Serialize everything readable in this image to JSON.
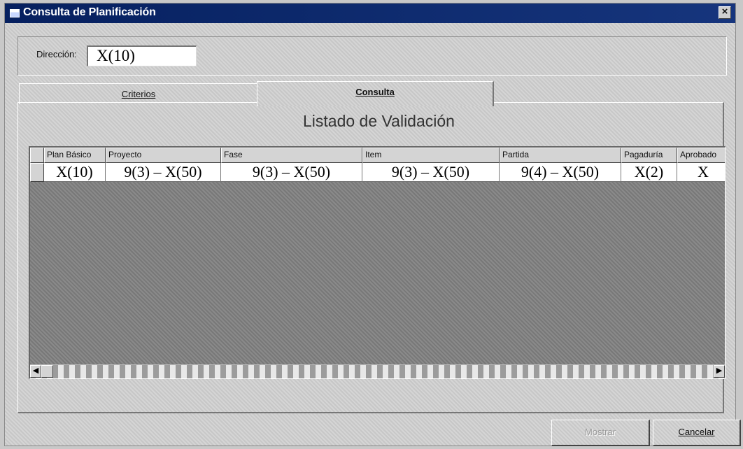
{
  "window": {
    "title": "Consulta de Planificación",
    "close_label": "×"
  },
  "direccion": {
    "label": "Dirección:",
    "value": "X(10)"
  },
  "tabs": [
    {
      "label": "Criterios"
    },
    {
      "label": "Consulta"
    }
  ],
  "listado": {
    "title": "Listado de Validación"
  },
  "table": {
    "columns": [
      "Plan Básico",
      "Proyecto",
      "Fase",
      "Item",
      "Partida",
      "Pagaduría",
      "Aprobado"
    ],
    "rows": [
      [
        "X(10)",
        "9(3) – X(50)",
        "9(3) – X(50)",
        "9(3) – X(50)",
        "9(4) – X(50)",
        "X(2)",
        "X"
      ]
    ]
  },
  "buttons": {
    "mostrar": "Mostrar",
    "cancelar": "Cancelar"
  },
  "scrollbar": {
    "left_arrow": "◀",
    "right_arrow": "▶"
  }
}
